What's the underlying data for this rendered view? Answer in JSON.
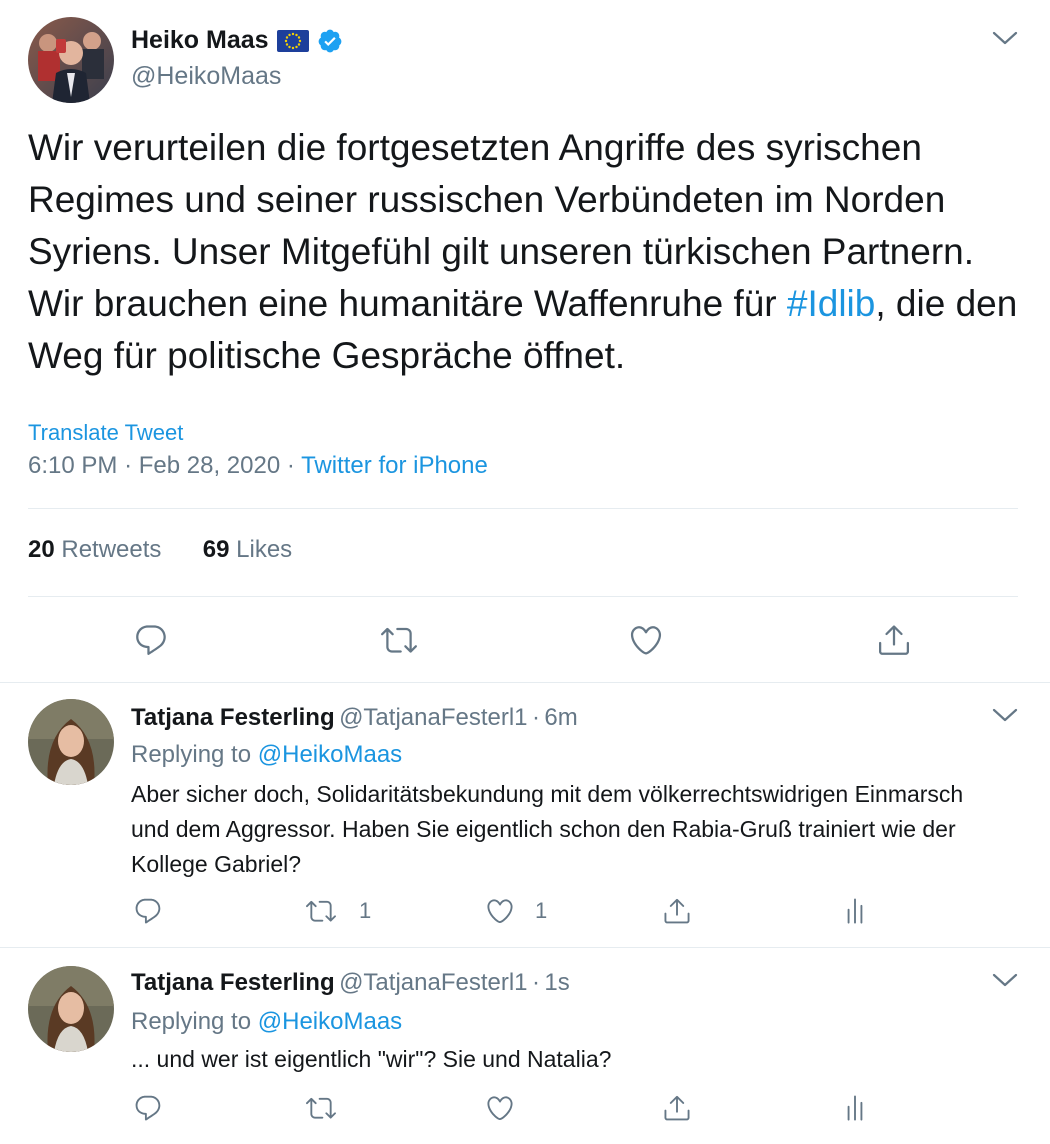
{
  "main_tweet": {
    "author_name": "Heiko Maas",
    "author_handle": "@HeikoMaas",
    "flag_icon": "eu-flag-icon",
    "verified_icon": "verified-badge-icon",
    "text_before": "Wir verurteilen die fortgesetzten Angriffe des syrischen Regimes und seiner russischen Verbündeten im Norden Syriens. Unser Mitgefühl gilt unseren türkischen Partnern. Wir brauchen eine humanitäre Waffenruhe für ",
    "hashtag": "#Idlib",
    "text_after": ", die den Weg für politische Gespräche öffnet.",
    "translate_label": "Translate Tweet",
    "time": "6:10 PM",
    "sep1": "·",
    "date": "Feb 28, 2020",
    "sep2": "·",
    "source": "Twitter for iPhone",
    "retweets_count": "20",
    "retweets_label": "Retweets",
    "likes_count": "69",
    "likes_label": "Likes"
  },
  "replies": [
    {
      "author_name": "Tatjana Festerling",
      "author_handle": "@TatjanaFesterl1",
      "sep": "·",
      "time_ago": "6m",
      "replying_prefix": "Replying to",
      "replying_handle": "@HeikoMaas",
      "text": "Aber sicher doch, Solidaritätsbekundung mit dem völkerrechtswidrigen Einmarsch und dem Aggressor. Haben Sie eigentlich schon den Rabia-Gruß trainiert wie der Kollege Gabriel?",
      "retweet_count": "1",
      "like_count": "1"
    },
    {
      "author_name": "Tatjana Festerling",
      "author_handle": "@TatjanaFesterl1",
      "sep": "·",
      "time_ago": "1s",
      "replying_prefix": "Replying to",
      "replying_handle": "@HeikoMaas",
      "text": "... und wer ist eigentlich \"wir\"? Sie und Natalia?",
      "retweet_count": "",
      "like_count": ""
    }
  ],
  "colors": {
    "link": "#1b95e0",
    "muted": "#657786",
    "text": "#14171a",
    "divider": "#e6ecf0"
  }
}
